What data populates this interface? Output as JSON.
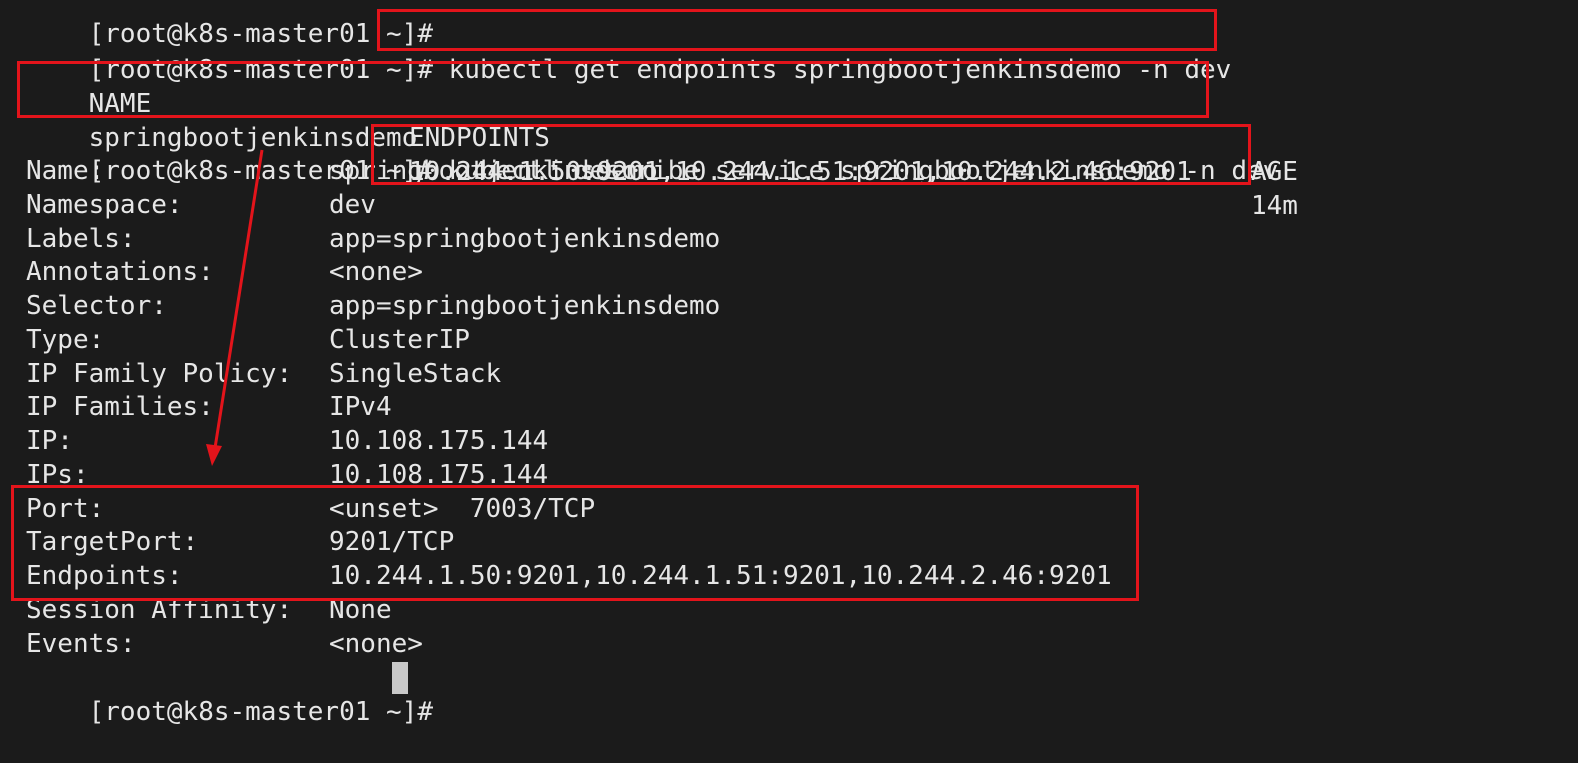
{
  "lines": {
    "top_prompt": "[root@k8s-master01 ~]#",
    "cmd1_prompt": "[root@k8s-master01 ~]#",
    "cmd1_command": " kubectl get endpoints springbootjenkinsdemo -n dev",
    "ep_header_name": "NAME",
    "ep_header_endpoints": "ENDPOINTS",
    "ep_header_age": "AGE",
    "ep_row_name": "springbootjenkinsdemo",
    "ep_row_endpoints": "10.244.1.50:9201,10.244.1.51:9201,10.244.2.46:9201",
    "ep_row_age": "14m",
    "cmd2_prompt": "[root@k8s-master01 ~]#",
    "cmd2_command": " kubectl describe service springbootjenkinsdemo -n dev"
  },
  "describe": [
    {
      "key": "Name:",
      "value": "springbootjenkinsdemo"
    },
    {
      "key": "Namespace:",
      "value": "dev"
    },
    {
      "key": "Labels:",
      "value": "app=springbootjenkinsdemo"
    },
    {
      "key": "Annotations:",
      "value": "<none>"
    },
    {
      "key": "Selector:",
      "value": "app=springbootjenkinsdemo"
    },
    {
      "key": "Type:",
      "value": "ClusterIP"
    },
    {
      "key": "IP Family Policy:",
      "value": "SingleStack"
    },
    {
      "key": "IP Families:",
      "value": "IPv4"
    },
    {
      "key": "IP:",
      "value": "10.108.175.144"
    },
    {
      "key": "IPs:",
      "value": "10.108.175.144"
    },
    {
      "key": "Port:",
      "value": "<unset>  7003/TCP"
    },
    {
      "key": "TargetPort:",
      "value": "9201/TCP"
    },
    {
      "key": "Endpoints:",
      "value": "10.244.1.50:9201,10.244.1.51:9201,10.244.2.46:9201"
    },
    {
      "key": "Session Affinity:",
      "value": "None"
    },
    {
      "key": "Events:",
      "value": "<none>"
    }
  ],
  "final_prompt": "[root@k8s-master01 ~]#",
  "colors": {
    "background": "#1b1b1b",
    "text": "#e6e6e6",
    "highlight": "#e3141b",
    "cursor": "#c8c8c8"
  }
}
